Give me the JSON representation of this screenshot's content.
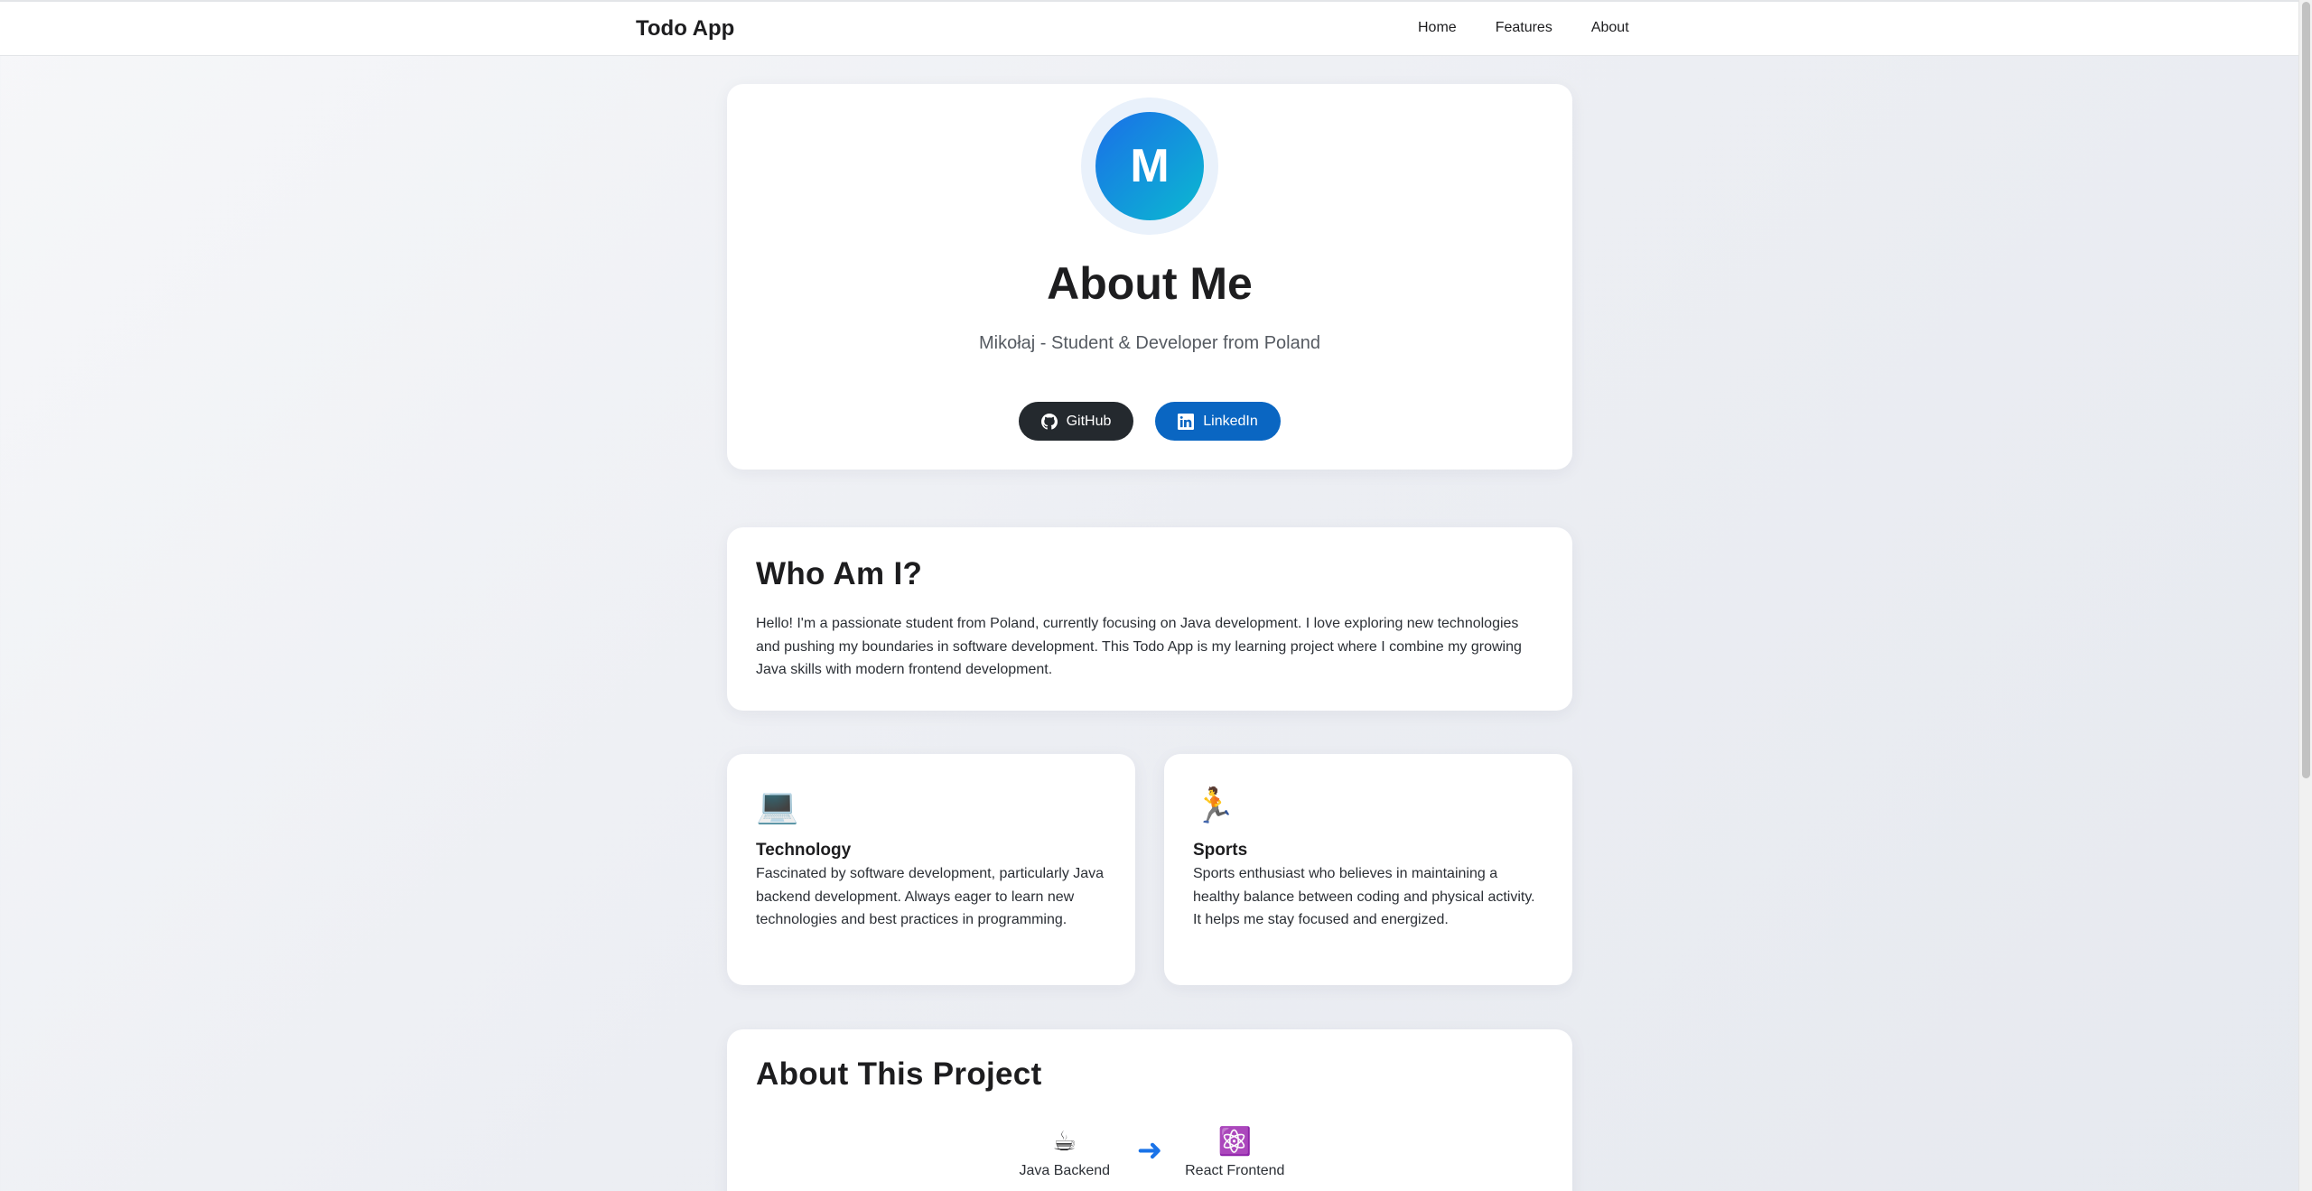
{
  "navbar": {
    "brand": "Todo App",
    "links": [
      "Home",
      "Features",
      "About"
    ]
  },
  "profile": {
    "avatar_initial": "M",
    "title": "About Me",
    "subtitle": "Mikołaj - Student & Developer from Poland",
    "github_label": "GitHub",
    "linkedin_label": "LinkedIn"
  },
  "whoami": {
    "title": "Who Am I?",
    "text": "Hello! I'm a passionate student from Poland, currently focusing on Java development. I love exploring new technologies and pushing my boundaries in software development. This Todo App is my learning project where I combine my growing Java skills with modern frontend development."
  },
  "interests": [
    {
      "icon": "laptop-icon",
      "emoji": "💻",
      "title": "Technology",
      "text": "Fascinated by software development, particularly Java backend development. Always eager to learn new technologies and best practices in programming."
    },
    {
      "icon": "runner-icon",
      "emoji": "🏃",
      "title": "Sports",
      "text": "Sports enthusiast who believes in maintaining a healthy balance between coding and physical activity. It helps me stay focused and energized."
    }
  ],
  "project": {
    "title": "About This Project",
    "stack": [
      {
        "icon": "coffee-icon",
        "emoji": "☕",
        "label": "Java Backend"
      },
      {
        "icon": "react-icon",
        "emoji": "⚛️",
        "label": "React Frontend"
      }
    ],
    "arrow": "➜"
  },
  "colors": {
    "github": "#24292e",
    "linkedin": "#0a66c2",
    "avatar_gradient_start": "#1a6fe8",
    "avatar_gradient_end": "#0bbad0",
    "arrow": "#1a73e8"
  }
}
